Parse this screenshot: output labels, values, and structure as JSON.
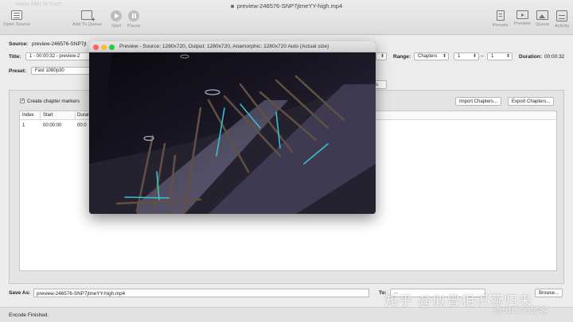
{
  "window": {
    "title": "preview-246576-SNP7jtmeYY-high.mp4",
    "watermark_url": "www.MacW.com"
  },
  "toolbar": {
    "open_source": "Open Source",
    "add_to_queue": "Add To Queue",
    "start": "Start",
    "pause": "Pause",
    "presets": "Presets",
    "preview": "Preview",
    "queue": "Queue",
    "activity": "Activity"
  },
  "form": {
    "source_label": "Source:",
    "source_value": "preview-246576-SNP7jt",
    "title_label": "Title:",
    "title_value": "1 - 00:00:32 - preview-2",
    "range_label": "Range:",
    "range_type": "Chapters",
    "range_from": "1",
    "range_separator": "–",
    "range_to": "1",
    "duration_label": "Duration:",
    "duration_value": "00:00:32",
    "preset_label": "Preset:",
    "preset_value": "Fast 1080p30",
    "tab_partial": "rs"
  },
  "chapters": {
    "create_markers_label": "Create chapter markers",
    "create_markers_checked": true,
    "import_button": "Import Chapters...",
    "export_button": "Export Chapters...",
    "columns": [
      "Index",
      "Start",
      "Durat"
    ],
    "rows": [
      {
        "index": "1",
        "start": "00:00:00",
        "duration": "00:0"
      }
    ]
  },
  "save": {
    "label": "Save As:",
    "value": "preview-246576-SNP7jtmeYY-high.mp4",
    "to_label": "To:",
    "to_value": "...",
    "browse_button": "Browse..."
  },
  "status": {
    "text": "Encode Finished."
  },
  "preview_window": {
    "title": "Preview - Source: 1280x720, Output: 1280x720, Anamorphic: 1280x720 Auto (Actual size)",
    "traffic_lights": {
      "close": "#fe5f57",
      "minimize": "#febc2e",
      "zoom": "#28c840"
    }
  },
  "overlay": {
    "zhihu_watermark": "知乎 @似曾相识燕归来",
    "blog_watermark": "@51CTO博客"
  },
  "colors": {
    "window_bg": "#ececec",
    "panel_bg": "#e4e4e4",
    "accent_cyan": "#41d6e6"
  }
}
